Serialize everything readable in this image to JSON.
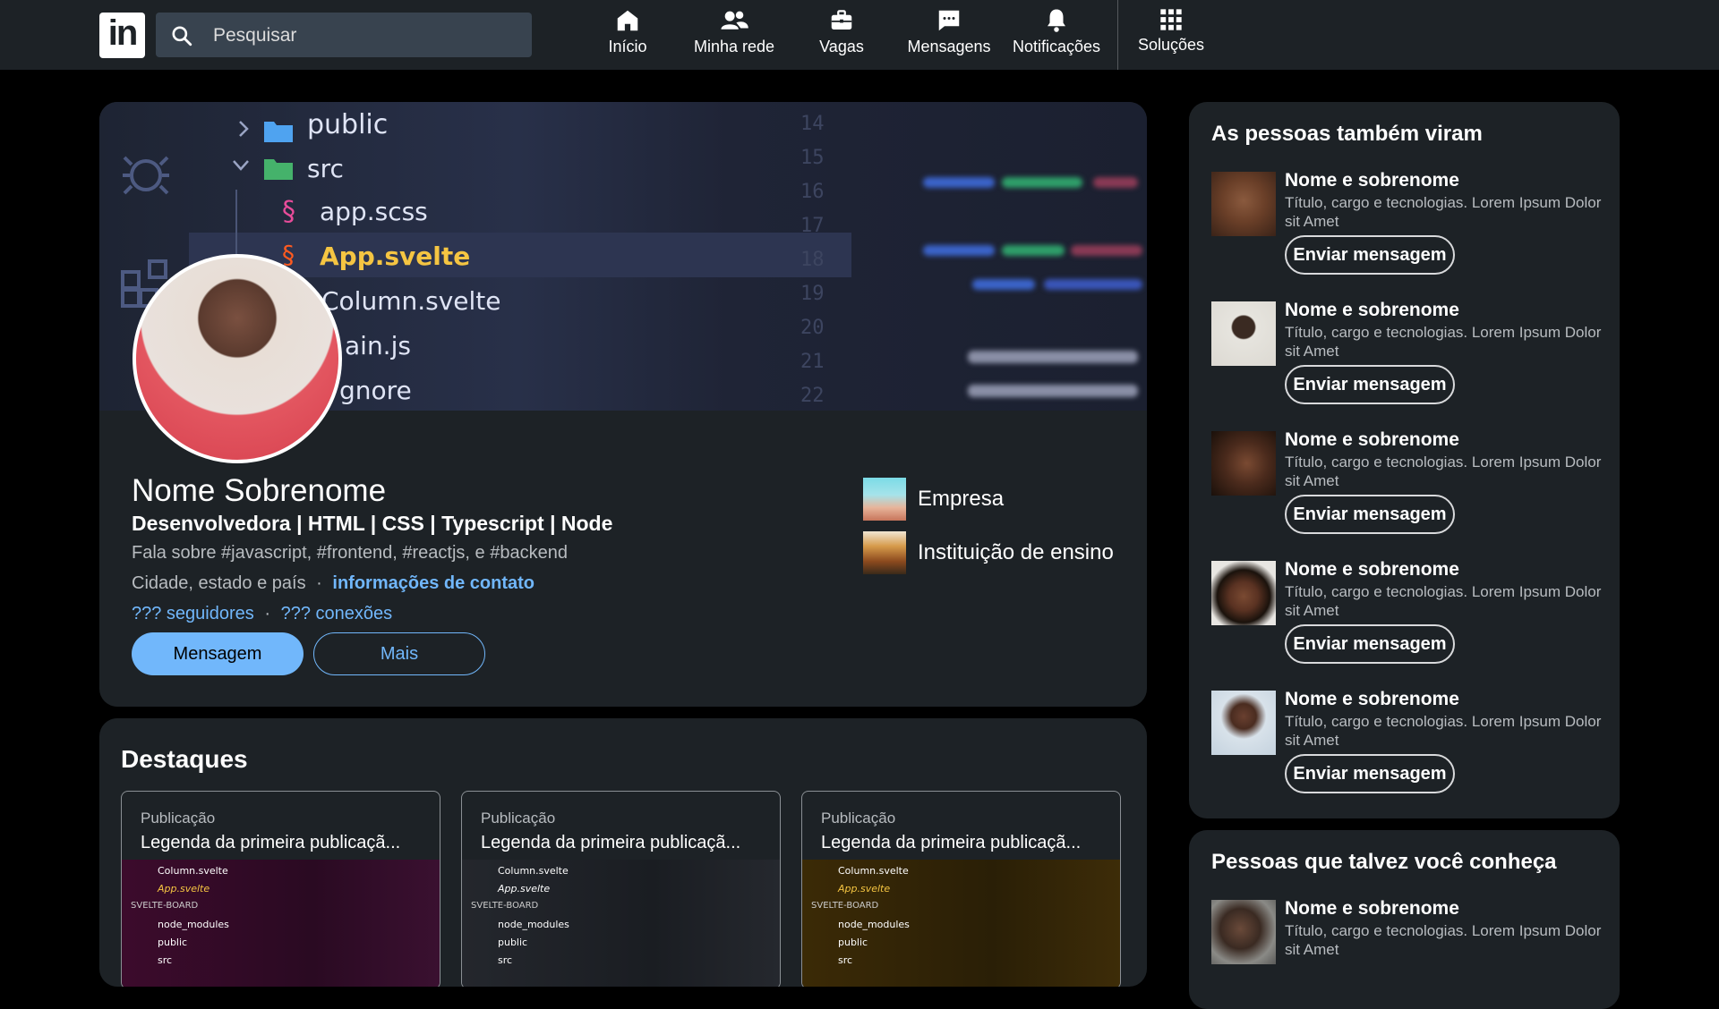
{
  "nav": {
    "logo": "in",
    "search_placeholder": "Pesquisar",
    "items": [
      {
        "label": "Início",
        "icon": "home-icon"
      },
      {
        "label": "Minha rede",
        "icon": "network-icon"
      },
      {
        "label": "Vagas",
        "icon": "briefcase-icon"
      },
      {
        "label": "Mensagens",
        "icon": "messaging-icon"
      },
      {
        "label": "Notificações",
        "icon": "bell-icon"
      },
      {
        "label": "Soluções",
        "icon": "grid-icon"
      }
    ]
  },
  "cover": {
    "files": [
      "public",
      "src",
      "app.scss",
      "App.svelte",
      "Column.svelte",
      "ain.js",
      "gnore"
    ],
    "line_numbers": [
      "14",
      "15",
      "16",
      "17",
      "18",
      "19",
      "20",
      "21",
      "22"
    ]
  },
  "profile": {
    "name": "Nome Sobrenome",
    "headline": "Desenvolvedora | HTML | CSS | Typescript | Node",
    "about": "Fala sobre #javascript, #frontend, #reactjs, e #backend",
    "location": "Cidade, estado e país",
    "separator": "·",
    "contact_link": "informações de contato",
    "followers": "??? seguidores",
    "connections": "??? conexões",
    "message_button": "Mensagem",
    "more_button": "Mais",
    "company": "Empresa",
    "school": "Instituição de ensino"
  },
  "featured": {
    "title": "Destaques",
    "items": [
      {
        "kind": "Publicação",
        "caption": "Legenda da primeira publicaçã...",
        "tint": "#3a0a2a"
      },
      {
        "kind": "Publicação",
        "caption": "Legenda da primeira publicaçã...",
        "tint": "#23262c"
      },
      {
        "kind": "Publicação",
        "caption": "Legenda da primeira publicaçã...",
        "tint": "#3a2a08"
      }
    ],
    "code_lines": [
      "Column.svelte",
      "App.svelte",
      "SVELTE-BOARD",
      "node_modules",
      "public",
      "src"
    ]
  },
  "sidebar": {
    "title": "As pessoas também viram",
    "people": [
      {
        "name": "Nome e sobrenome",
        "desc": "Título, cargo e tecnologias. Lorem Ipsum Dolor sit Amet",
        "button": "Enviar mensagem"
      },
      {
        "name": "Nome e sobrenome",
        "desc": "Título, cargo e tecnologias. Lorem Ipsum Dolor sit Amet",
        "button": "Enviar mensagem"
      },
      {
        "name": "Nome e sobrenome",
        "desc": "Título, cargo e tecnologias. Lorem Ipsum Dolor sit Amet",
        "button": "Enviar mensagem"
      },
      {
        "name": "Nome e sobrenome",
        "desc": "Título, cargo e tecnologias. Lorem Ipsum Dolor sit Amet",
        "button": "Enviar mensagem"
      },
      {
        "name": "Nome e sobrenome",
        "desc": "Título, cargo e tecnologias. Lorem Ipsum Dolor sit Amet",
        "button": "Enviar mensagem"
      }
    ],
    "title2": "Pessoas que talvez você conheça",
    "people2": [
      {
        "name": "Nome e sobrenome",
        "desc": "Título, cargo e tecnologias. Lorem Ipsum Dolor sit Amet"
      }
    ]
  },
  "colors": {
    "accent": "#71b7fb",
    "card_bg": "#1d2226",
    "page_bg": "#000000"
  }
}
